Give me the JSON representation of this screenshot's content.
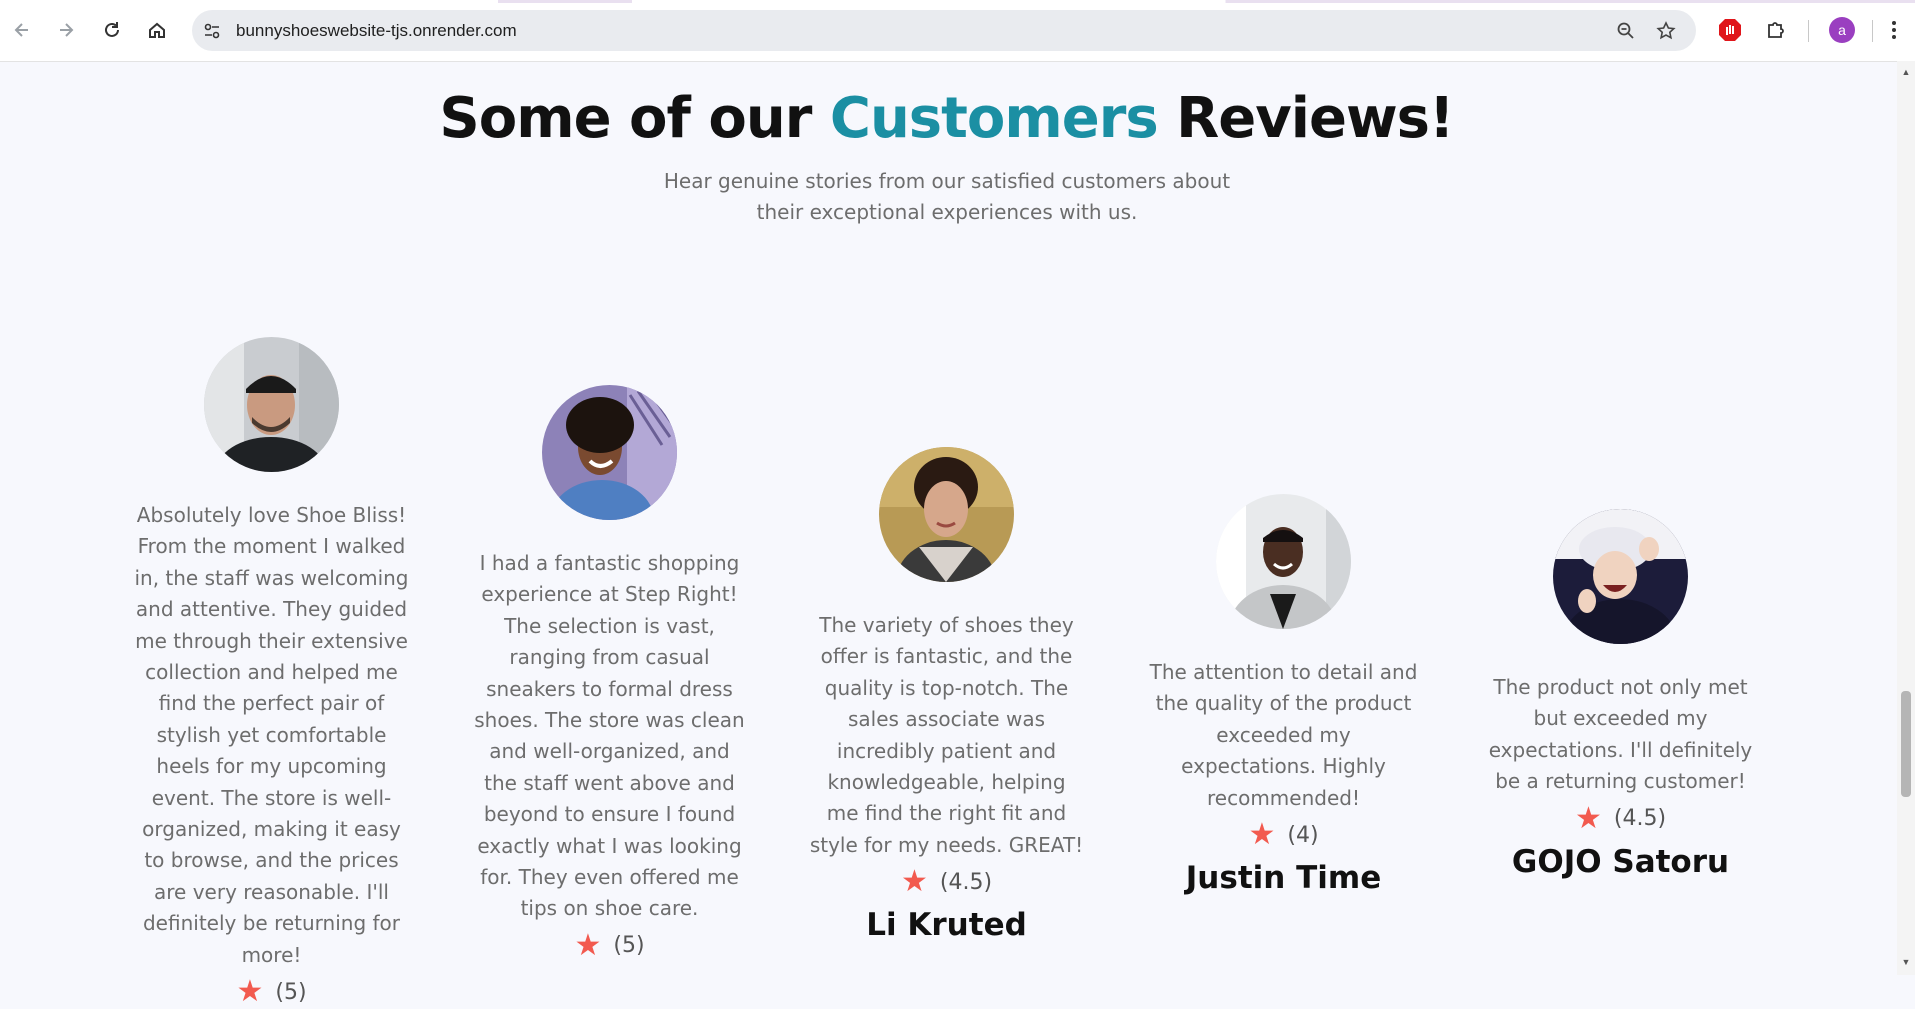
{
  "browser": {
    "url": "bunnyshoeswebsite-tjs.onrender.com",
    "profile_initial": "a",
    "icons": [
      "back-arrow-icon",
      "forward-arrow-icon",
      "reload-icon",
      "home-icon",
      "site-info-icon",
      "zoom-icon",
      "bookmark-star-icon",
      "adblock-extension-icon",
      "extensions-puzzle-icon",
      "profile-avatar",
      "more-menu-icon"
    ]
  },
  "section": {
    "title_prefix": "Some of our ",
    "title_accent": "Customers",
    "title_suffix": " Reviews!",
    "subtitle": "Hear genuine stories from our satisfied customers about their exceptional experiences with us.",
    "accent_color": "#1b8fa3",
    "star_color": "#f25a4f"
  },
  "reviews": [
    {
      "text": "Absolutely love Shoe Bliss! From the moment I walked in, the staff was welcoming and attentive. They guided me through their extensive collection and helped me find the perfect pair of stylish yet comfortable heels for my upcoming event. The store is well-organized, making it easy to browse, and the prices are very reasonable. I'll definitely be returning for more!",
      "rating": "(5)",
      "name": ""
    },
    {
      "text": "I had a fantastic shopping experience at Step Right! The selection is vast, ranging from casual sneakers to formal dress shoes. The store was clean and well-organized, and the staff went above and beyond to ensure I found exactly what I was looking for. They even offered me tips on shoe care.",
      "rating": "(5)",
      "name": ""
    },
    {
      "text": "The variety of shoes they offer is fantastic, and the quality is top-notch. The sales associate was incredibly patient and knowledgeable, helping me find the right fit and style for my needs. GREAT!",
      "rating": "(4.5)",
      "name": "Li Kruted"
    },
    {
      "text": "The attention to detail and the quality of the product exceeded my expectations. Highly recommended!",
      "rating": "(4)",
      "name": "Justin Time"
    },
    {
      "text": "The product not only met but exceeded my expectations. I'll definitely be a returning customer!",
      "rating": "(4.5)",
      "name": "GOJO Satoru"
    }
  ]
}
